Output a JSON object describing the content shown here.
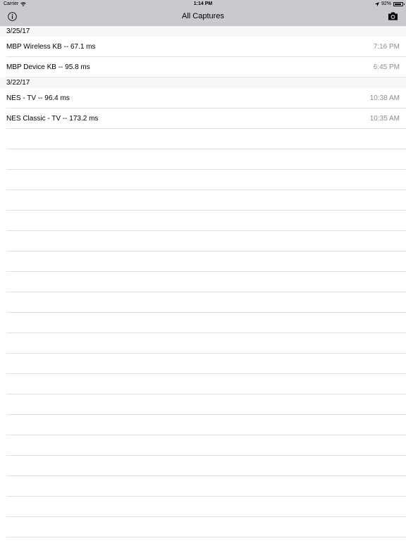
{
  "status_bar": {
    "carrier": "Carrier",
    "time": "1:14 PM",
    "battery": "92%",
    "battery_level": 0.92,
    "icons": [
      "wifi-icon",
      "location-arrow-icon",
      "battery-icon"
    ]
  },
  "nav_bar": {
    "title": "All Captures",
    "left_icon": "info-icon",
    "right_icon": "camera-icon"
  },
  "sections": [
    {
      "header": "3/25/17",
      "rows": [
        {
          "title": "MBP Wireless KB -- 67.1 ms",
          "time": "7:16 PM"
        },
        {
          "title": "MBP Device KB -- 95.8 ms",
          "time": "6:45 PM"
        }
      ]
    },
    {
      "header": "3/22/17",
      "rows": [
        {
          "title": "NES - TV -- 96.4 ms",
          "time": "10:38 AM"
        },
        {
          "title": "NES Classic - TV -- 173.2 ms",
          "time": "10:35 AM"
        }
      ]
    }
  ],
  "colors": {
    "bar_background": "#c9c9ce",
    "section_background": "#f7f7f7",
    "separator": "#e0e0e0",
    "secondary_text": "#8e8e93"
  }
}
